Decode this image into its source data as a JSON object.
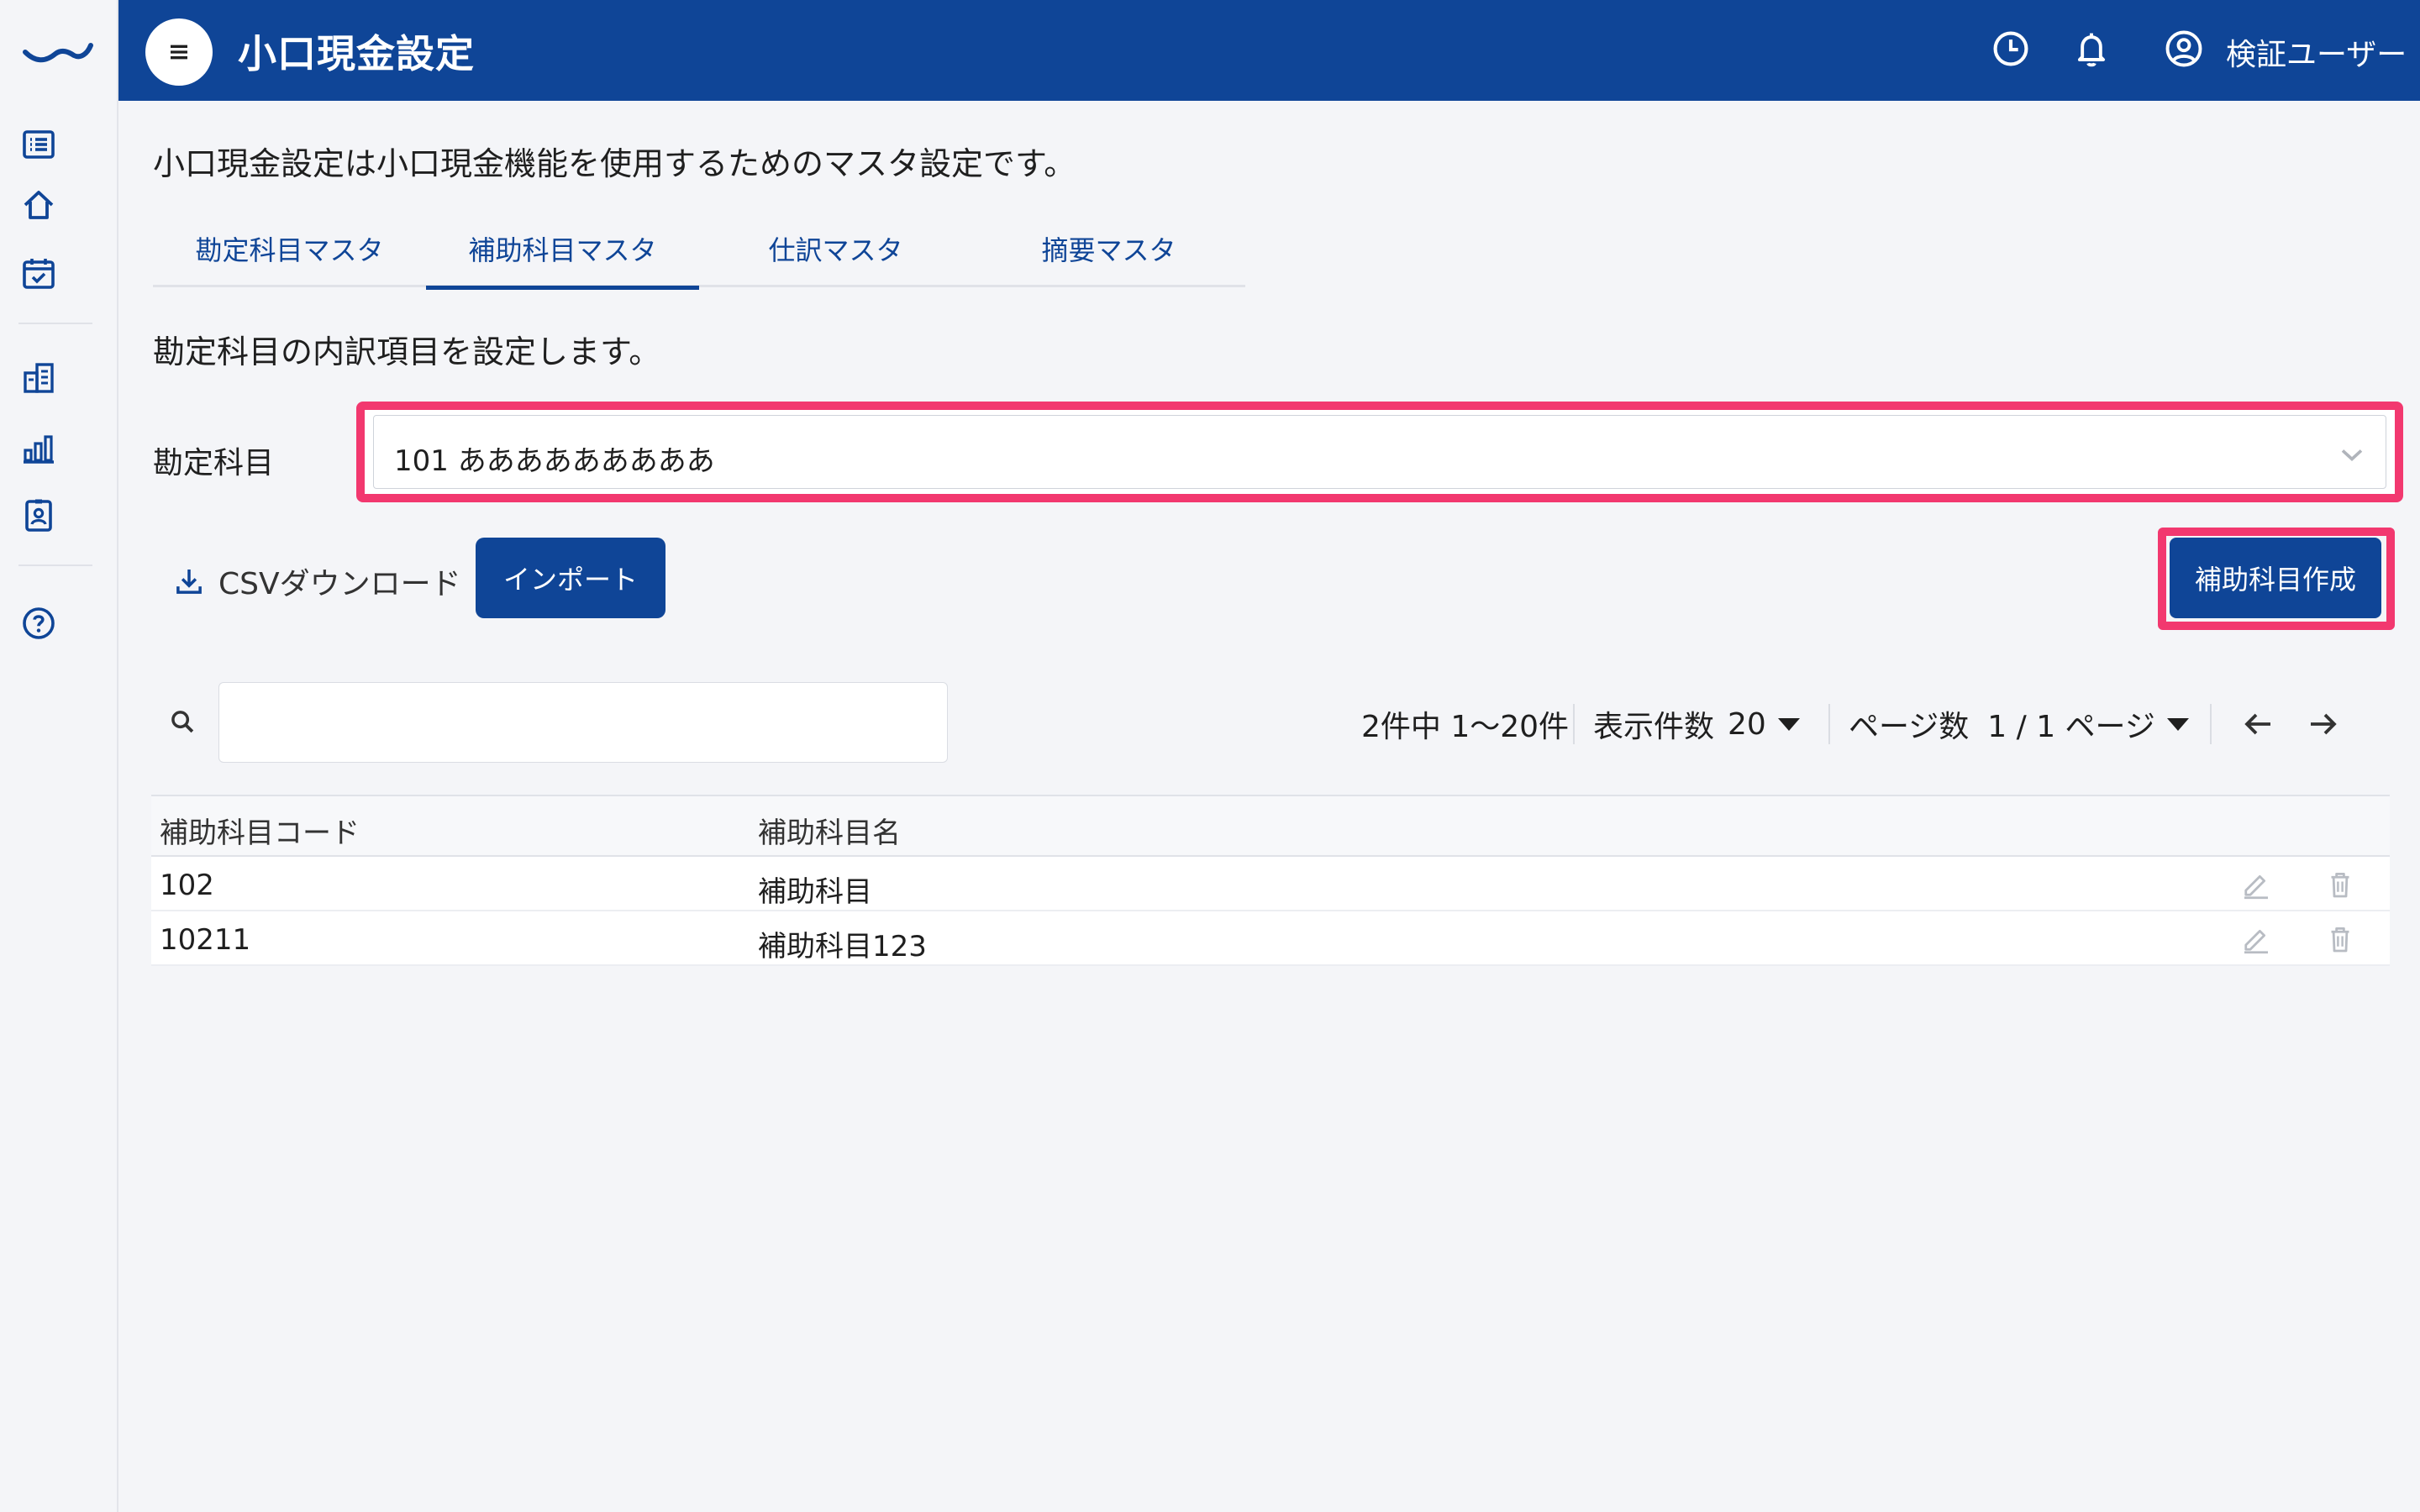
{
  "header": {
    "title": "小口現金設定",
    "user_name": "検証ユーザー"
  },
  "main": {
    "intro": "小口現金設定は小口現金機能を使用するためのマスタ設定です。",
    "tabs": [
      {
        "label": "勘定科目マスタ",
        "active": false
      },
      {
        "label": "補助科目マスタ",
        "active": true
      },
      {
        "label": "仕訳マスタ",
        "active": false
      },
      {
        "label": "摘要マスタ",
        "active": false
      }
    ],
    "section_desc": "勘定科目の内訳項目を設定します。",
    "account": {
      "label": "勘定科目",
      "selected": "101 あああああああああ"
    },
    "toolbar": {
      "csv_label": "CSVダウンロード",
      "import_label": "インポート",
      "create_label": "補助科目作成"
    },
    "search": {
      "value": "",
      "placeholder": ""
    },
    "pager": {
      "count_text": "2件中 1〜20件",
      "per_page_label": "表示件数",
      "per_page_value": "20",
      "page_label": "ページ数",
      "page_value": "1 / 1 ページ"
    },
    "table": {
      "headers": [
        "補助科目コード",
        "補助科目名"
      ],
      "rows": [
        {
          "code": "102",
          "name": "補助科目"
        },
        {
          "code": "10211",
          "name": "補助科目123"
        }
      ]
    }
  },
  "icons": {
    "sidebar": [
      "list-icon",
      "home-icon",
      "calendar-check-icon",
      "building-icon",
      "bar-chart-icon",
      "id-badge-icon",
      "help-icon"
    ],
    "header": [
      "history-icon",
      "bell-icon",
      "user-circle-icon"
    ]
  },
  "colors": {
    "brand": "#0f4597",
    "highlight": "#f2386f",
    "background": "#f4f5f8"
  }
}
